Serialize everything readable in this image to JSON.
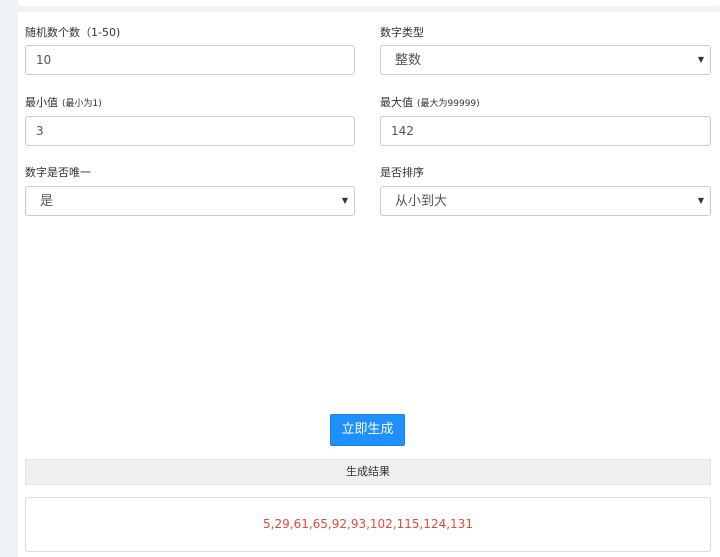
{
  "form": {
    "count": {
      "label": "随机数个数（1-50)",
      "value": "10"
    },
    "number_type": {
      "label": "数字类型",
      "selected": "整数"
    },
    "min": {
      "label": "最小值",
      "hint": "(最小为1)",
      "value": "3"
    },
    "max": {
      "label": "最大值",
      "hint": "(最大为99999)",
      "value": "142"
    },
    "unique": {
      "label": "数字是否唯一",
      "selected": "是"
    },
    "sort": {
      "label": "是否排序",
      "selected": "从小到大"
    }
  },
  "generate_button": "立即生成",
  "result": {
    "header": "生成结果",
    "value": "5,29,61,65,92,93,102,115,124,131"
  },
  "icons": {
    "dropdown": "chevron-down-icon"
  },
  "colors": {
    "accent": "#1e90ff",
    "result_text": "#e04a3f"
  }
}
